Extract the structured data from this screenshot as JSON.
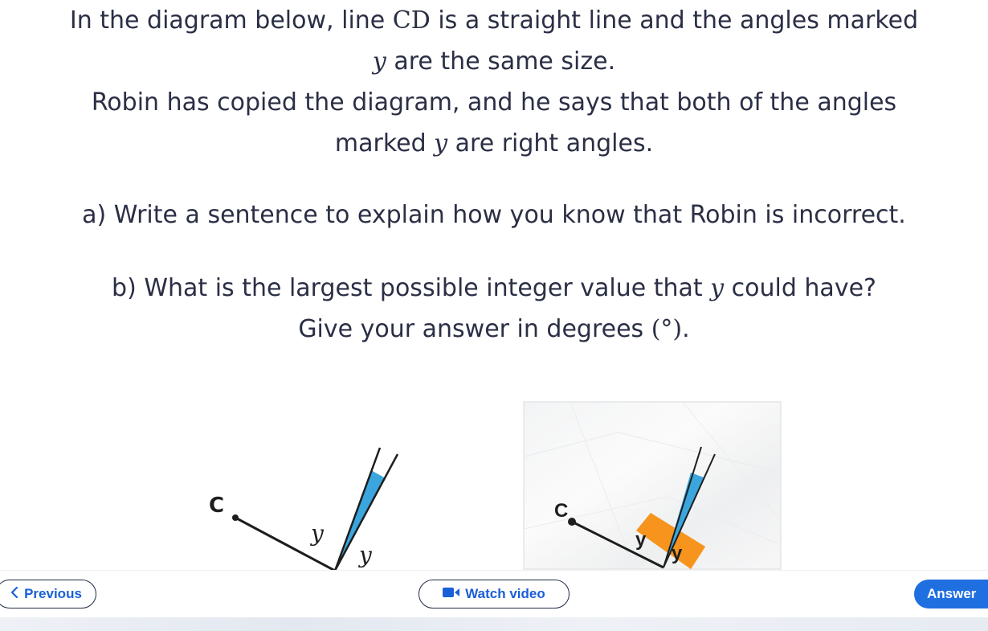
{
  "question": {
    "line1_before": "In the diagram below, line ",
    "line1_math": "CD",
    "line1_after": " is a straight line and the angles marked",
    "line2_math": "y",
    "line2_after": " are the same size.",
    "line3": "Robin has copied the diagram, and he says that both of the angles",
    "line4_before": "marked ",
    "line4_math": "y",
    "line4_after": " are right angles.",
    "part_a": "a) Write a sentence to explain how you know that Robin is incorrect.",
    "part_b_before": "b) What is the largest possible integer value that ",
    "part_b_math": "y",
    "part_b_after": " could have?",
    "part_b2_before": "Give your answer in degrees ",
    "part_b2_math": "(°)",
    "part_b2_after": "."
  },
  "diagram_left": {
    "point_label": "C",
    "angle_label_1": "y",
    "angle_label_2": "y",
    "wedge_color": "#3aa6dd"
  },
  "diagram_right": {
    "point_label": "C",
    "angle_label_1": "y",
    "angle_label_2": "y",
    "marker_color": "#f7941d",
    "wedge_color": "#3aa6dd"
  },
  "nav": {
    "previous_label": "Previous",
    "previous_icon": "chevron-left-icon",
    "video_label": "Watch video",
    "video_icon": "video-camera-icon",
    "answer_label": "Answer"
  },
  "colors": {
    "primary": "#1f6fe0",
    "link_text": "#1a5fd6",
    "text": "#2a2f45"
  }
}
